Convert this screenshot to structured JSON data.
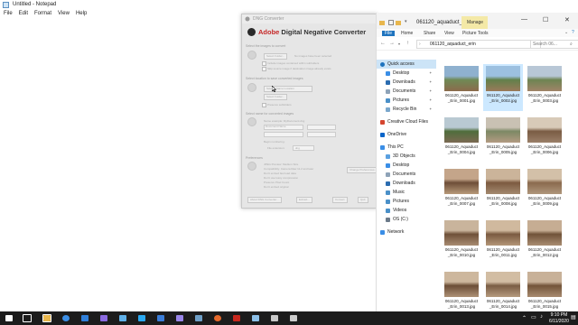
{
  "notepad": {
    "title": "Untitled - Notepad",
    "menu": [
      "File",
      "Edit",
      "Format",
      "View",
      "Help"
    ]
  },
  "dng": {
    "window_title": "DNG Converter",
    "brand_adobe": "Adobe",
    "brand_rest": " Digital Negative Converter",
    "sec1": "Select the images to convert",
    "sec1_btn": "Select Folder...",
    "sec1_note": "No images have been selected",
    "sec1_opt1": "Include images contained within subfolders",
    "sec1_opt2": "Skip source image if destination image already exists",
    "sec2": "Select location to save converted images",
    "sec2_select": "Save in Same Location",
    "sec2_btn": "Select Folder...",
    "sec2_opt": "Preserve subfolders",
    "sec3": "Select name for converted images",
    "sec3_example": "Name example:   MyDocument.dng",
    "sec3_doc": "Document Name",
    "sec3_serial": "Begin numbering:",
    "sec3_ext_label": "File extension:",
    "sec3_ext": ".dng",
    "sec4": "Preferences",
    "prefs": [
      "JPEG Preview: Medium Size",
      "Compatibility: Camera Raw 11.2 and later",
      "Don't embed fast load data",
      "Don't use lossy compression",
      "Preserve Pixel Count",
      "Don't embed original"
    ],
    "change_prefs": "Change Preferences...",
    "about": "About DNG Converter...",
    "extract": "Extract...",
    "convert": "Convert",
    "quit": "Quit"
  },
  "explorer": {
    "title": "061120_aquaduct_e...",
    "manage": "Manage",
    "tabs": [
      "File",
      "Home",
      "Share",
      "View",
      "Picture Tools"
    ],
    "address": "061120_aquaduct_erin",
    "search_placeholder": "Search 06...",
    "nav": [
      {
        "label": "Quick access",
        "icon": "star-icon",
        "color": "#1e73be",
        "pinned": false,
        "indent": 4
      },
      {
        "label": "Desktop",
        "icon": "desktop-icon",
        "color": "#3a8ee6",
        "pinned": true,
        "indent": 10
      },
      {
        "label": "Downloads",
        "icon": "download-icon",
        "color": "#2b6cb0",
        "pinned": true,
        "indent": 10
      },
      {
        "label": "Documents",
        "icon": "documents-icon",
        "color": "#8ea3b8",
        "pinned": true,
        "indent": 10
      },
      {
        "label": "Pictures",
        "icon": "pictures-icon",
        "color": "#4a90c8",
        "pinned": true,
        "indent": 10
      },
      {
        "label": "Recycle Bin",
        "icon": "recycle-bin-icon",
        "color": "#7aa7cc",
        "pinned": true,
        "indent": 10
      },
      {
        "label": "Creative Cloud Files",
        "icon": "creative-cloud-icon",
        "color": "#d4452f",
        "pinned": false,
        "indent": 4
      },
      {
        "label": "OneDrive",
        "icon": "onedrive-icon",
        "color": "#0a64c8",
        "pinned": false,
        "indent": 4
      },
      {
        "label": "This PC",
        "icon": "this-pc-icon",
        "color": "#3a8ee6",
        "pinned": false,
        "indent": 4
      },
      {
        "label": "3D Objects",
        "icon": "3d-objects-icon",
        "color": "#5aa0e0",
        "pinned": false,
        "indent": 10
      },
      {
        "label": "Desktop",
        "icon": "desktop-icon",
        "color": "#3a8ee6",
        "pinned": false,
        "indent": 10
      },
      {
        "label": "Documents",
        "icon": "documents-icon",
        "color": "#8ea3b8",
        "pinned": false,
        "indent": 10
      },
      {
        "label": "Downloads",
        "icon": "download-icon",
        "color": "#2b6cb0",
        "pinned": false,
        "indent": 10
      },
      {
        "label": "Music",
        "icon": "music-icon",
        "color": "#4a90c8",
        "pinned": false,
        "indent": 10
      },
      {
        "label": "Pictures",
        "icon": "pictures-icon",
        "color": "#4a90c8",
        "pinned": false,
        "indent": 10
      },
      {
        "label": "Videos",
        "icon": "videos-icon",
        "color": "#4a90c8",
        "pinned": false,
        "indent": 10
      },
      {
        "label": "OS (C:)",
        "icon": "drive-icon",
        "color": "#6c7a89",
        "pinned": false,
        "indent": 10
      },
      {
        "label": "Network",
        "icon": "network-icon",
        "color": "#3a8ee6",
        "pinned": false,
        "indent": 4
      }
    ],
    "files": [
      {
        "line1": "061120_Aquaduct",
        "line2": "_Erin_0001.jpg",
        "selected": false,
        "colors": [
          "#8fb1cf",
          "#6f8a55",
          "#8c6a4c"
        ]
      },
      {
        "line1": "061120_Aquaduct",
        "line2": "_Erin_0002.jpg",
        "selected": true,
        "colors": [
          "#9cc0e0",
          "#62804a",
          "#9a7a5a"
        ]
      },
      {
        "line1": "061120_Aquaduct",
        "line2": "_Erin_0003.jpg",
        "selected": false,
        "colors": [
          "#b8c7d6",
          "#6e8452",
          "#a08468"
        ]
      },
      {
        "line1": "061120_Aquaduct",
        "line2": "_Erin_0004.jpg",
        "selected": false,
        "colors": [
          "#b9c9d2",
          "#4f6d3c",
          "#7c6a52"
        ]
      },
      {
        "line1": "061120_Aquaduct",
        "line2": "_Erin_0005.jpg",
        "selected": false,
        "colors": [
          "#c9c1b3",
          "#7c8864",
          "#b39b83"
        ]
      },
      {
        "line1": "061120_Aquaduct",
        "line2": "_Erin_0006.jpg",
        "selected": false,
        "colors": [
          "#d8cab8",
          "#7a5c44",
          "#9b806a"
        ]
      },
      {
        "line1": "061120_Aquaduct",
        "line2": "_Erin_0007.jpg",
        "selected": false,
        "colors": [
          "#c4a58a",
          "#6d4e38",
          "#b89a7a"
        ]
      },
      {
        "line1": "061120_Aquaduct",
        "line2": "_Erin_0008.jpg",
        "selected": false,
        "colors": [
          "#cbb49a",
          "#7c5a40",
          "#a48a70"
        ]
      },
      {
        "line1": "061120_Aquaduct",
        "line2": "_Erin_0009.jpg",
        "selected": false,
        "colors": [
          "#d3c0a8",
          "#8a6a4e",
          "#b0977c"
        ]
      },
      {
        "line1": "061120_Aquaduct",
        "line2": "_Erin_0010.jpg",
        "selected": false,
        "colors": [
          "#c9b49c",
          "#6e5038",
          "#a88c72"
        ]
      },
      {
        "line1": "061120_Aquaduct",
        "line2": "_Erin_0011.jpg",
        "selected": false,
        "colors": [
          "#d0b99e",
          "#7a5a40",
          "#b39678"
        ]
      },
      {
        "line1": "061120_Aquaduct",
        "line2": "_Erin_0012.jpg",
        "selected": false,
        "colors": [
          "#c6ad93",
          "#705238",
          "#a98d72"
        ]
      },
      {
        "line1": "061120_Aquaduct",
        "line2": "_Erin_0013.jpg",
        "selected": false,
        "colors": [
          "#cdb79d",
          "#6b4d36",
          "#ad9175"
        ]
      },
      {
        "line1": "061120_Aquaduct",
        "line2": "_Erin_0014.jpg",
        "selected": false,
        "colors": [
          "#d2bda3",
          "#7a5d44",
          "#b59a7e"
        ]
      },
      {
        "line1": "061120_Aquaduct",
        "line2": "_Erin_0015.jpg",
        "selected": false,
        "colors": [
          "#c8b198",
          "#735439",
          "#a88b70"
        ]
      }
    ]
  },
  "taskbar": {
    "time": "9:10 PM",
    "date": "6/11/2020",
    "apps": [
      {
        "name": "start-button",
        "icon": "windows-icon",
        "color": "#ffffff"
      },
      {
        "name": "search-taskbar-button",
        "icon": "search-icon",
        "color": "#ffffff"
      },
      {
        "name": "task-view-button",
        "icon": "task-view-icon",
        "color": "#ffffff"
      },
      {
        "name": "file-explorer-taskbar-button",
        "icon": "folder-icon",
        "color": "#e8b64c"
      },
      {
        "name": "edge-taskbar-button",
        "icon": "edge-icon",
        "color": "#3c8fe6"
      },
      {
        "name": "mail-taskbar-button",
        "icon": "mail-icon",
        "color": "#2f7fd9"
      },
      {
        "name": "bridge-taskbar-button",
        "icon": "bridge-icon",
        "color": "#8a6ae0"
      },
      {
        "name": "lightroom-taskbar-button",
        "icon": "lightroom-icon",
        "color": "#5fb0e8"
      },
      {
        "name": "photoshop-taskbar-button",
        "icon": "photoshop-icon",
        "color": "#2aa8f0"
      },
      {
        "name": "sync-taskbar-button",
        "icon": "sync-icon",
        "color": "#3b7dd8"
      },
      {
        "name": "premiere-taskbar-button",
        "icon": "premiere-icon",
        "color": "#9a86ea"
      },
      {
        "name": "app-taskbar-button",
        "icon": "app-icon",
        "color": "#6fa0c8"
      },
      {
        "name": "firefox-taskbar-button",
        "icon": "firefox-icon",
        "color": "#e66a2c"
      },
      {
        "name": "filezilla-taskbar-button",
        "icon": "filezilla-icon",
        "color": "#c8281e"
      },
      {
        "name": "notepad-taskbar-button",
        "icon": "notepad-icon",
        "color": "#8cc0e8"
      },
      {
        "name": "dng-taskbar-button",
        "icon": "dng-icon",
        "color": "#c8c8c8"
      },
      {
        "name": "camera-taskbar-button",
        "icon": "camera-icon",
        "color": "#cccccc"
      }
    ]
  }
}
